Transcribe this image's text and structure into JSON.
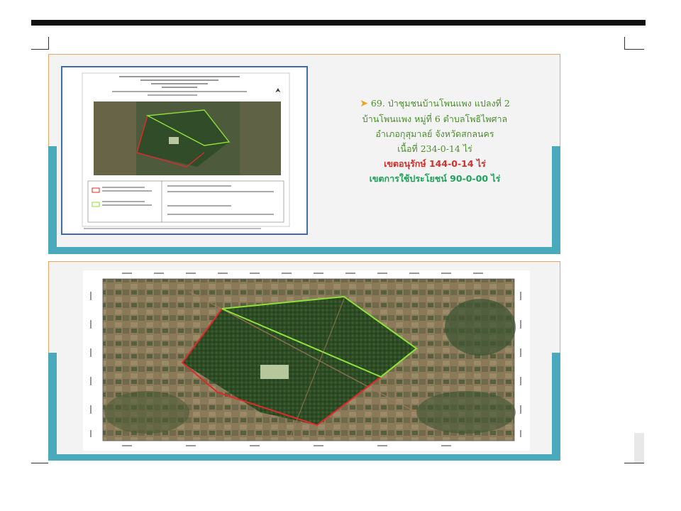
{
  "title_line": "69. ป่าชุมชนบ้านโพนแพง  แปลงที่ 2",
  "location_line1": "บ้านโพนแพง  หมู่ที่  6  ตำบลโพธิไพศาล",
  "location_line2": "อำเภอกุสุมาลย์  จังหวัดสกลนคร",
  "area_line": "เนื้อที่  234-0-14 ไร่",
  "conservation_line": "เขตอนุรักษ์  144-0-14  ไร่",
  "utilization_line": "เขตการใช้ประโยชน์   90-0-00  ไร่",
  "colors": {
    "accent_orange": "#e7a567",
    "teal": "#4aa9bd",
    "conservation_red": "#d0312d",
    "utilization_green": "#8ee03a"
  }
}
